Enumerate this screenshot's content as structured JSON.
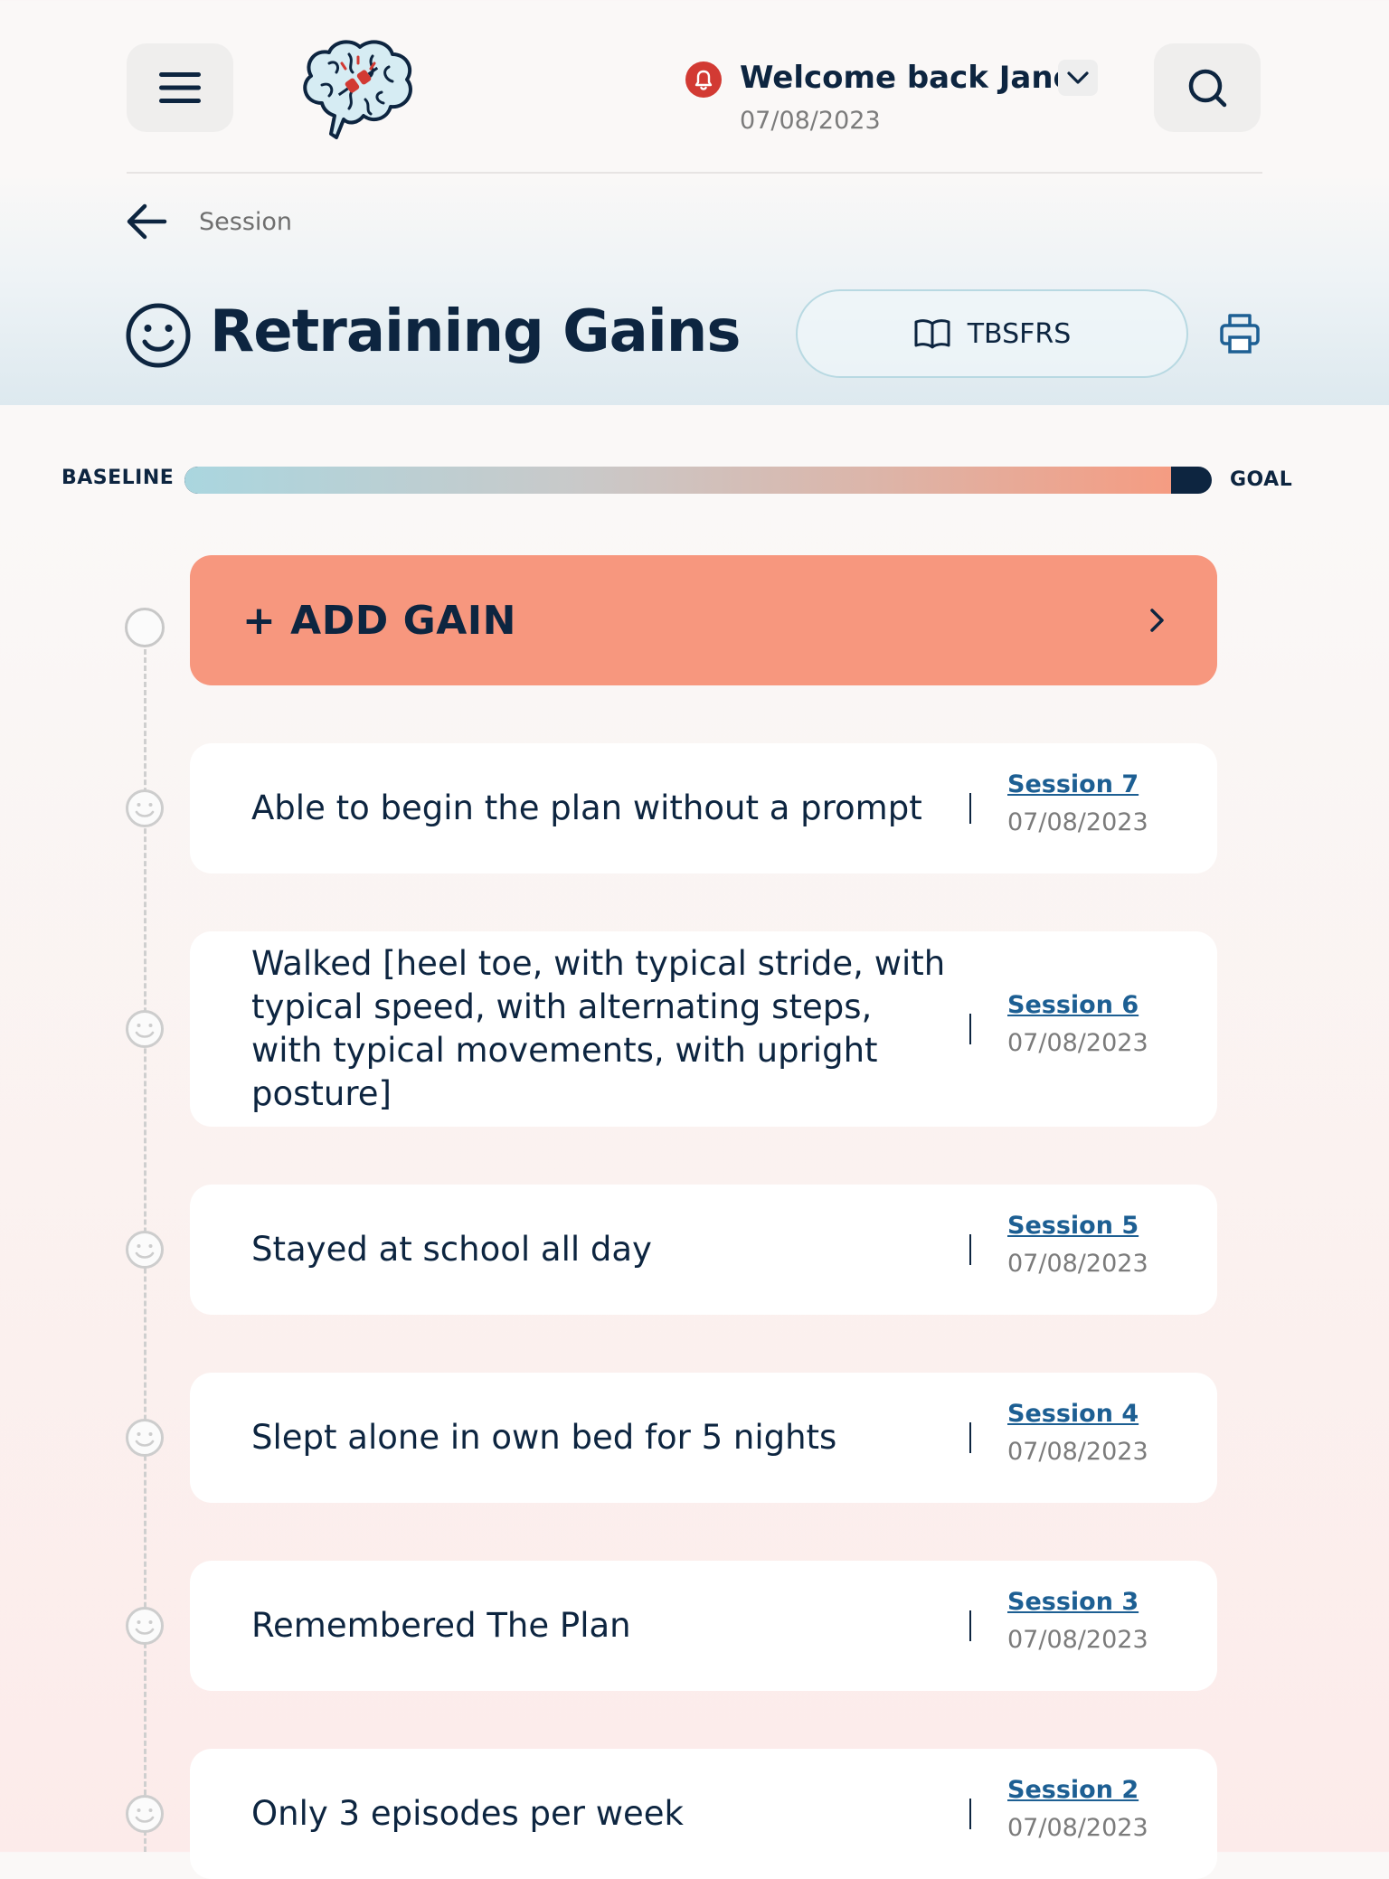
{
  "header": {
    "welcome": "Welcome back Jane",
    "date": "07/08/2023"
  },
  "breadcrumb": {
    "label": "Session"
  },
  "page": {
    "title": "Retraining Gains",
    "resource_button": "TBSFRS"
  },
  "progress": {
    "start_label": "BASELINE",
    "end_label": "GOAL",
    "fraction": 0.96
  },
  "add_gain": {
    "label": "+ ADD GAIN"
  },
  "gains": [
    {
      "text": "Able to begin the plan without a prompt",
      "session": "Session 7",
      "date": "07/08/2023"
    },
    {
      "text": "Walked [heel toe, with typical stride, with typical speed, with alternating steps, with typical movements, with upright posture]",
      "session": "Session 6",
      "date": "07/08/2023"
    },
    {
      "text": "Stayed at school all day",
      "session": "Session 5",
      "date": "07/08/2023"
    },
    {
      "text": "Slept alone in own bed for 5 nights",
      "session": "Session 4",
      "date": "07/08/2023"
    },
    {
      "text": "Remembered The Plan",
      "session": "Session 3",
      "date": "07/08/2023"
    },
    {
      "text": "Only 3 episodes per week",
      "session": "Session 2",
      "date": "07/08/2023"
    }
  ],
  "icons": {
    "menu": "hamburger-menu-icon",
    "logo": "brain-logo",
    "notification": "bell-icon",
    "account_menu": "chevron-down-icon",
    "search": "search-icon",
    "back": "back-arrow-icon",
    "title": "smiley-icon",
    "resource": "open-book-icon",
    "print": "printer-icon",
    "add_gain": "chevron-right-icon",
    "timeline_node": "smiley-icon"
  },
  "colors": {
    "primary": "#0d2540",
    "accent": "#f7977e",
    "link": "#1d5f93",
    "alert": "#d23a33"
  }
}
